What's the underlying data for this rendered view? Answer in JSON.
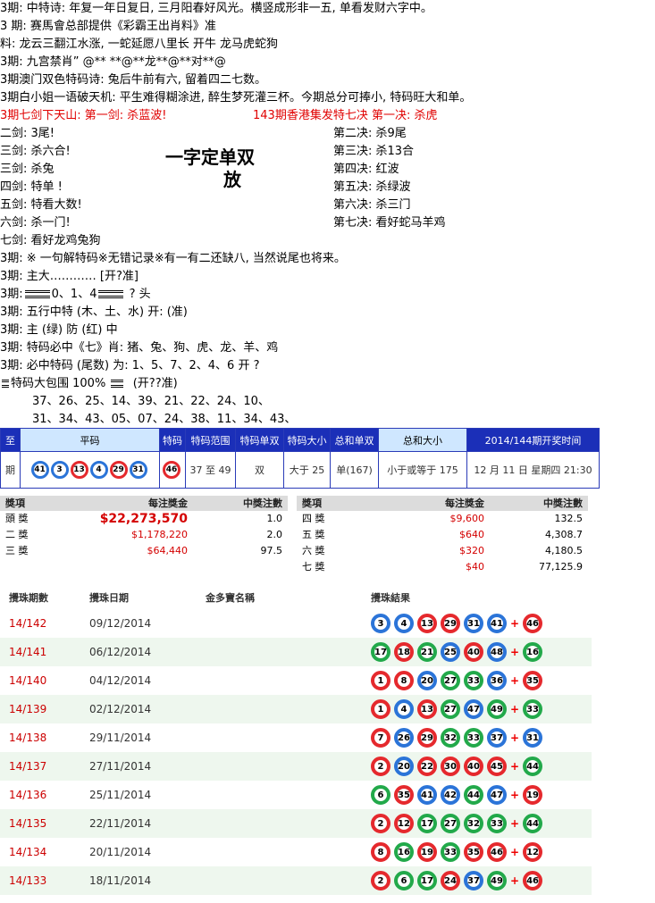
{
  "lines": {
    "l1": "3期: 中特诗: 年复一年日复日, 三月阳春好风光。横竖成形非一五, 单看发财六字中。",
    "l2": "3 期: 赛馬會总部提供《彩霸王出肖料》准",
    "l3": "料: 龙云三翻江水涨, 一蛇延愿八里长  开牛  龙马虎蛇狗",
    "l4": "3期: 九宫禁肖”  @** **@**龙**@**对**@",
    "l5": "3期澳门双色特码诗: 兔后牛前有六, 留着四二七数。",
    "l6": "3期白小姐一语破天机: 平生难得糊涂进, 醉生梦死灌三杯。今期总分可捧小, 特码旺大和单。",
    "l7a": "3期七剑下天山: 第一剑: 杀蓝波!",
    "l7b": "143期香港集发特七决  第一决:      杀虎",
    "j2": "二剑: 3尾!",
    "j3": "三剑: 杀六合!",
    "j4": "三剑: 杀兔",
    "j5": "四剑: 特单 !",
    "j6": "五剑: 特看大数!",
    "j7": "六剑: 杀一门!",
    "j8": "七剑: 看好龙鸡兔狗",
    "k2": "第二决: 杀9尾",
    "k3": "第三决: 杀13合",
    "k4": "第四决: 红波",
    "k5": "第五决: 杀绿波",
    "k6": "第六决: 杀三门",
    "k7": "第七决: 看好蛇马羊鸡",
    "title1": "一字定单双",
    "title2": "放",
    "m1": "3期: ※ 一句解特码※无错记录※有一有二还缺八, 当然说尾也将来。",
    "m2": "3期: 主大………… [开?准]",
    "m3a": "3期:",
    "m3b": "0、1、4",
    "m3c": "? 头",
    "m4": "3期: 五行中特   (木、土、水) 开: (准)",
    "m5": "3期: 主 (绿) 防 (红) 中",
    "m6": "3期: 特码必中《七》肖:  猪、兔、狗、虎、龙、羊、鸡",
    "m7": "3期: 必中特码 (尾数) 为: 1、5、7、2、4、6     开 ?",
    "m8a": "特码大包围 100%",
    "m8b": "(开??准)",
    "m9": "37、26、25、14、39、21、22、24、10、",
    "m10": "31、34、43、05、07、24、38、11、34、43、"
  },
  "draw": {
    "headers": [
      "至",
      "平码",
      "特码",
      "特码范围",
      "特码单双",
      "特码大小",
      "总和单双",
      "总和大小",
      "2014/144期开奖时间"
    ],
    "row_label": "期",
    "normal_balls": [
      {
        "n": "41",
        "c": "blue"
      },
      {
        "n": "3",
        "c": "blue"
      },
      {
        "n": "13",
        "c": "red"
      },
      {
        "n": "4",
        "c": "blue"
      },
      {
        "n": "29",
        "c": "red"
      },
      {
        "n": "31",
        "c": "blue"
      }
    ],
    "special_ball": {
      "n": "46",
      "c": "red"
    },
    "range": "37 至 49",
    "odd_even": "双",
    "big_small": "大于 25",
    "sum_odd_even": "单(167)",
    "sum_big_small": "小于或等于 175",
    "time": "12 月 11 日 星期四  21:30"
  },
  "prize": {
    "headers": [
      "獎項",
      "每注獎金",
      "中獎注數"
    ],
    "left": [
      {
        "name": "頭 獎",
        "money": "$22,273,570",
        "count": "1.0"
      },
      {
        "name": "二 獎",
        "money": "$1,178,220",
        "count": "2.0"
      },
      {
        "name": "三 獎",
        "money": "$64,440",
        "count": "97.5"
      }
    ],
    "right": [
      {
        "name": "四 獎",
        "money": "$9,600",
        "count": "132.5"
      },
      {
        "name": "五 獎",
        "money": "$640",
        "count": "4,308.7"
      },
      {
        "name": "六 獎",
        "money": "$320",
        "count": "4,180.5"
      },
      {
        "name": "七 獎",
        "money": "$40",
        "count": "77,125.9"
      }
    ]
  },
  "history": {
    "headers": [
      "攪珠期數",
      "攪珠日期",
      "金多寶名稱",
      "攪珠結果"
    ],
    "rows": [
      {
        "period": "14/142",
        "date": "09/12/2014",
        "balls": [
          [
            "3",
            "blue"
          ],
          [
            "4",
            "blue"
          ],
          [
            "13",
            "red"
          ],
          [
            "29",
            "red"
          ],
          [
            "31",
            "blue"
          ],
          [
            "41",
            "blue"
          ]
        ],
        "special": [
          "46",
          "red"
        ]
      },
      {
        "period": "14/141",
        "date": "06/12/2014",
        "balls": [
          [
            "17",
            "green"
          ],
          [
            "18",
            "red"
          ],
          [
            "21",
            "green"
          ],
          [
            "25",
            "blue"
          ],
          [
            "40",
            "red"
          ],
          [
            "48",
            "blue"
          ]
        ],
        "special": [
          "16",
          "green"
        ]
      },
      {
        "period": "14/140",
        "date": "04/12/2014",
        "balls": [
          [
            "1",
            "red"
          ],
          [
            "8",
            "red"
          ],
          [
            "20",
            "blue"
          ],
          [
            "27",
            "green"
          ],
          [
            "33",
            "green"
          ],
          [
            "36",
            "blue"
          ]
        ],
        "special": [
          "35",
          "red"
        ]
      },
      {
        "period": "14/139",
        "date": "02/12/2014",
        "balls": [
          [
            "1",
            "red"
          ],
          [
            "4",
            "blue"
          ],
          [
            "13",
            "red"
          ],
          [
            "27",
            "green"
          ],
          [
            "47",
            "blue"
          ],
          [
            "49",
            "green"
          ]
        ],
        "special": [
          "33",
          "green"
        ]
      },
      {
        "period": "14/138",
        "date": "29/11/2014",
        "balls": [
          [
            "7",
            "red"
          ],
          [
            "26",
            "blue"
          ],
          [
            "29",
            "red"
          ],
          [
            "32",
            "green"
          ],
          [
            "33",
            "green"
          ],
          [
            "37",
            "blue"
          ]
        ],
        "special": [
          "31",
          "blue"
        ]
      },
      {
        "period": "14/137",
        "date": "27/11/2014",
        "balls": [
          [
            "2",
            "red"
          ],
          [
            "20",
            "blue"
          ],
          [
            "22",
            "red"
          ],
          [
            "30",
            "red"
          ],
          [
            "40",
            "red"
          ],
          [
            "45",
            "red"
          ]
        ],
        "special": [
          "44",
          "green"
        ]
      },
      {
        "period": "14/136",
        "date": "25/11/2014",
        "balls": [
          [
            "6",
            "green"
          ],
          [
            "35",
            "red"
          ],
          [
            "41",
            "blue"
          ],
          [
            "42",
            "blue"
          ],
          [
            "44",
            "green"
          ],
          [
            "47",
            "blue"
          ]
        ],
        "special": [
          "19",
          "red"
        ]
      },
      {
        "period": "14/135",
        "date": "22/11/2014",
        "balls": [
          [
            "2",
            "red"
          ],
          [
            "12",
            "red"
          ],
          [
            "17",
            "green"
          ],
          [
            "27",
            "green"
          ],
          [
            "32",
            "green"
          ],
          [
            "33",
            "green"
          ]
        ],
        "special": [
          "44",
          "green"
        ]
      },
      {
        "period": "14/134",
        "date": "20/11/2014",
        "balls": [
          [
            "8",
            "red"
          ],
          [
            "16",
            "green"
          ],
          [
            "19",
            "red"
          ],
          [
            "33",
            "green"
          ],
          [
            "35",
            "red"
          ],
          [
            "46",
            "red"
          ]
        ],
        "special": [
          "12",
          "red"
        ]
      },
      {
        "period": "14/133",
        "date": "18/11/2014",
        "balls": [
          [
            "2",
            "red"
          ],
          [
            "6",
            "green"
          ],
          [
            "17",
            "green"
          ],
          [
            "24",
            "red"
          ],
          [
            "37",
            "blue"
          ],
          [
            "49",
            "green"
          ]
        ],
        "special": [
          "46",
          "red"
        ]
      }
    ]
  }
}
